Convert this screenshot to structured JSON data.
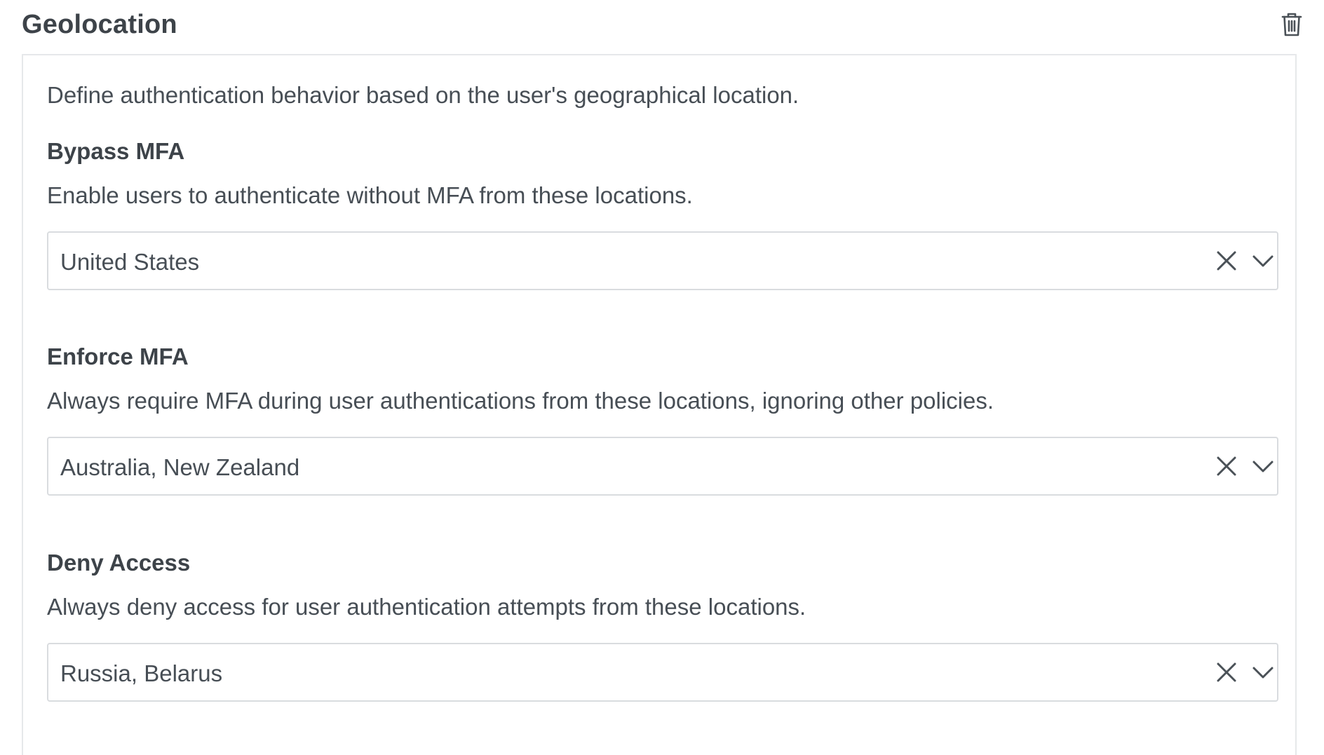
{
  "header": {
    "title": "Geolocation",
    "delete_icon": "trash-icon"
  },
  "intro": "Define authentication behavior based on the user's geographical location.",
  "sections": [
    {
      "title": "Bypass MFA",
      "description": "Enable users to authenticate without MFA from these locations.",
      "selected": "United States"
    },
    {
      "title": "Enforce MFA",
      "description": "Always require MFA during user authentications from these locations, ignoring other policies.",
      "selected": "Australia, New Zealand"
    },
    {
      "title": "Deny Access",
      "description": "Always deny access for user authentication attempts from these locations.",
      "selected": "Russia, Belarus"
    }
  ],
  "icons": {
    "clear": "close-icon",
    "expand": "chevron-down-icon"
  },
  "colors": {
    "text": "#474e55",
    "heading": "#3d4349",
    "border": "#d9dcdf",
    "panel_border": "#e6e8ea",
    "icon": "#4a5157"
  }
}
